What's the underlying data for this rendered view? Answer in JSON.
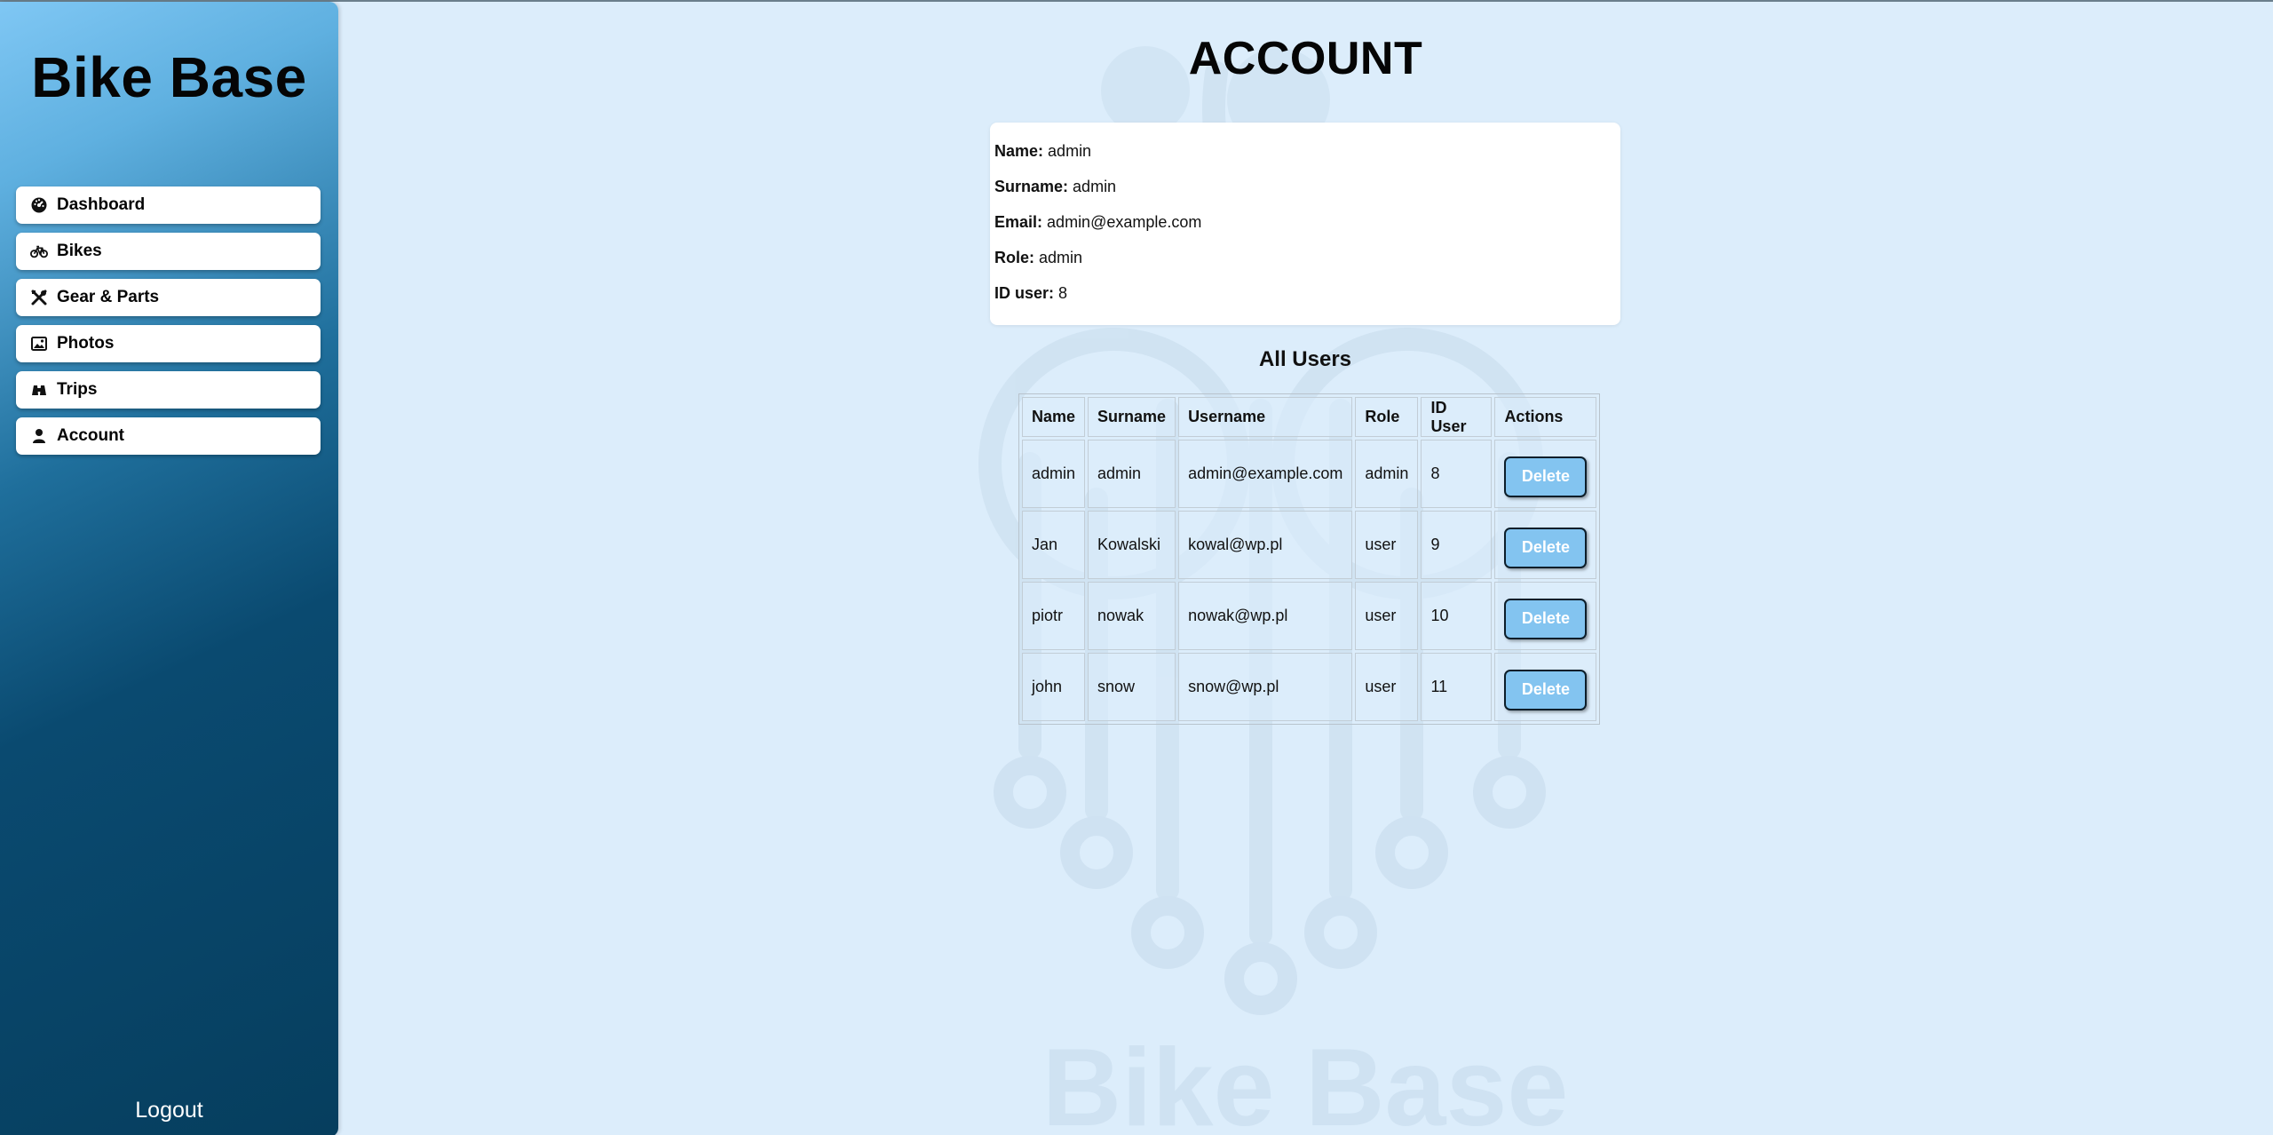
{
  "app": {
    "brand": "Bike Base"
  },
  "sidebar": {
    "items": [
      {
        "label": "Dashboard",
        "icon": "dashboard-gauge-icon"
      },
      {
        "label": "Bikes",
        "icon": "bicycle-icon"
      },
      {
        "label": "Gear & Parts",
        "icon": "tools-icon"
      },
      {
        "label": "Photos",
        "icon": "image-icon"
      },
      {
        "label": "Trips",
        "icon": "binoculars-icon"
      },
      {
        "label": "Account",
        "icon": "user-icon"
      }
    ],
    "logout": "Logout"
  },
  "main": {
    "title": "ACCOUNT",
    "profile": {
      "name_label": "Name:",
      "name": "admin",
      "surname_label": "Surname:",
      "surname": "admin",
      "email_label": "Email:",
      "email": "admin@example.com",
      "role_label": "Role:",
      "role": "admin",
      "id_label": "ID user:",
      "id": "8"
    },
    "users_title": "All Users",
    "table": {
      "headers": [
        "Name",
        "Surname",
        "Username",
        "Role",
        "ID User",
        "Actions"
      ],
      "rows": [
        {
          "name": "admin",
          "surname": "admin",
          "username": "admin@example.com",
          "role": "admin",
          "id": "8",
          "action": "Delete"
        },
        {
          "name": "Jan",
          "surname": "Kowalski",
          "username": "kowal@wp.pl",
          "role": "user",
          "id": "9",
          "action": "Delete"
        },
        {
          "name": "piotr",
          "surname": "nowak",
          "username": "nowak@wp.pl",
          "role": "user",
          "id": "10",
          "action": "Delete"
        },
        {
          "name": "john",
          "surname": "snow",
          "username": "snow@wp.pl",
          "role": "user",
          "id": "11",
          "action": "Delete"
        }
      ]
    }
  },
  "watermark": {
    "text": "Bike Base"
  },
  "colors": {
    "background": "#dcedfb",
    "button": "#83c4f0",
    "sidebar_dark": "#063e5e",
    "sidebar_light": "#7fc7f4"
  }
}
